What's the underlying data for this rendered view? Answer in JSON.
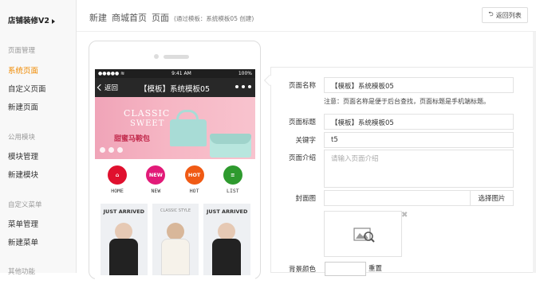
{
  "sidebar": {
    "store_title": "店铺装修V2",
    "groups": [
      {
        "title": "页面管理",
        "items": [
          {
            "label": "系统页面",
            "active": true
          },
          {
            "label": "自定义页面"
          },
          {
            "label": "新建页面"
          }
        ]
      },
      {
        "title": "公用模块",
        "items": [
          {
            "label": "模块管理"
          },
          {
            "label": "新建模块"
          }
        ]
      },
      {
        "title": "自定义菜单",
        "items": [
          {
            "label": "菜单管理"
          },
          {
            "label": "新建菜单"
          }
        ]
      },
      {
        "title": "其他功能",
        "items": []
      }
    ]
  },
  "header": {
    "crumbs": [
      "新建",
      "商城首页",
      "页面"
    ],
    "note": "(通过模板：系统模板05 创建)",
    "back_label": "返回列表"
  },
  "phone": {
    "status_left": "●●●●● ≋",
    "status_time": "9:41 AM",
    "status_right": "100%",
    "back_label": "返回",
    "title": "【模板】系统模板05",
    "banner_line1": "CLASSIC",
    "banner_line2": "SWEET",
    "banner_line3": "甜蜜马鞍包",
    "nav": [
      {
        "badge": "⌂",
        "label": "HOME",
        "color": "#e0102e"
      },
      {
        "badge": "NEW",
        "label": "NEW",
        "color": "#e21a78"
      },
      {
        "badge": "HOT",
        "label": "HOT",
        "color": "#f05a14"
      },
      {
        "badge": "≡",
        "label": "LIST",
        "color": "#2e9a2e"
      }
    ],
    "products": [
      {
        "header": "JUST ARRIVED",
        "style": "dark"
      },
      {
        "header": "CLASSIC STYLE",
        "style": "light"
      },
      {
        "header": "JUST ARRIVED",
        "style": "dark"
      }
    ]
  },
  "form": {
    "page_name_label": "页面名称",
    "page_name_value": "【模板】系统模板05",
    "page_name_note": "注意：页面名称是便于后台查找，页面标题是手机端标题。",
    "page_title_label": "页面标题",
    "page_title_value": "【模板】系统模板05",
    "keywords_label": "关键字",
    "keywords_value": "t5",
    "intro_label": "页面介绍",
    "intro_placeholder": "请输入页面介绍",
    "cover_label": "封面图",
    "cover_button": "选择图片",
    "bg_label": "背景颜色",
    "bg_reset": "重置"
  },
  "colors": {
    "accent": "#f08a00",
    "dark_bar": "#282828"
  }
}
